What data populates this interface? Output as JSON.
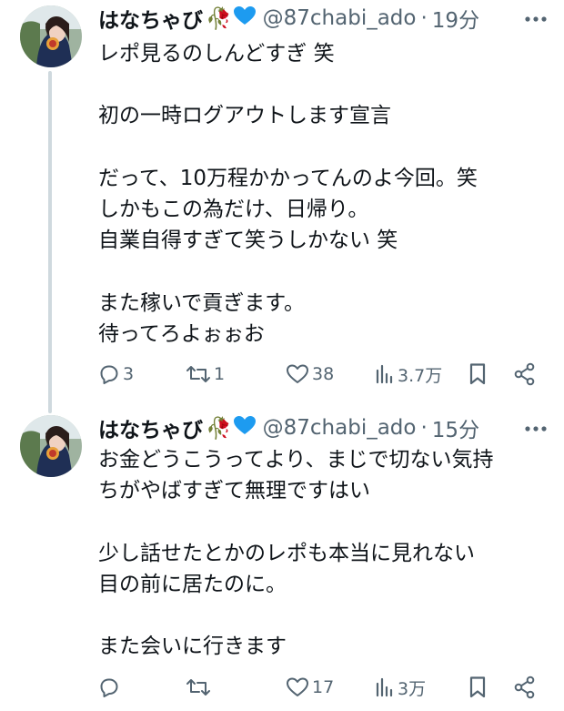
{
  "tweets": [
    {
      "name": "はなちゃび",
      "flower_emoji": "🥀",
      "heart_emoji": "💙",
      "handle": "@87chabi_ado",
      "dot": "·",
      "time": "19分",
      "lines": [
        "レポ見るのしんどすぎ 笑",
        "",
        "初の一時ログアウトします宣言",
        "",
        "だって、10万程かかってんのよ今回。笑",
        "しかもこの為だけ、日帰り。",
        "自業自得すぎて笑うしかない 笑",
        "",
        "また稼いで貢ぎます。",
        "待ってろよぉぉお"
      ],
      "actions": {
        "replies": "3",
        "retweets": "1",
        "likes": "38",
        "views": "3.7万"
      }
    },
    {
      "name": "はなちゃび",
      "flower_emoji": "🥀",
      "heart_emoji": "💙",
      "handle": "@87chabi_ado",
      "dot": "·",
      "time": "15分",
      "lines": [
        "お金どうこうってより、まじで切ない気持",
        "ちがやばすぎて無理ですはい",
        "",
        "少し話せたとかのレポも本当に見れない",
        "目の前に居たのに。",
        "",
        "また会いに行きます"
      ],
      "actions": {
        "replies": "",
        "retweets": "",
        "likes": "17",
        "views": "3万"
      }
    }
  ],
  "icons": {
    "reply": "reply-icon",
    "retweet": "retweet-icon",
    "like": "heart-icon",
    "views": "views-icon",
    "bookmark": "bookmark-icon",
    "share": "share-icon",
    "more": "more-icon"
  },
  "colors": {
    "text": "#0f1419",
    "secondary": "#536471",
    "thread_line": "#cfd9de",
    "heart_blue": "#1d9bf0"
  }
}
